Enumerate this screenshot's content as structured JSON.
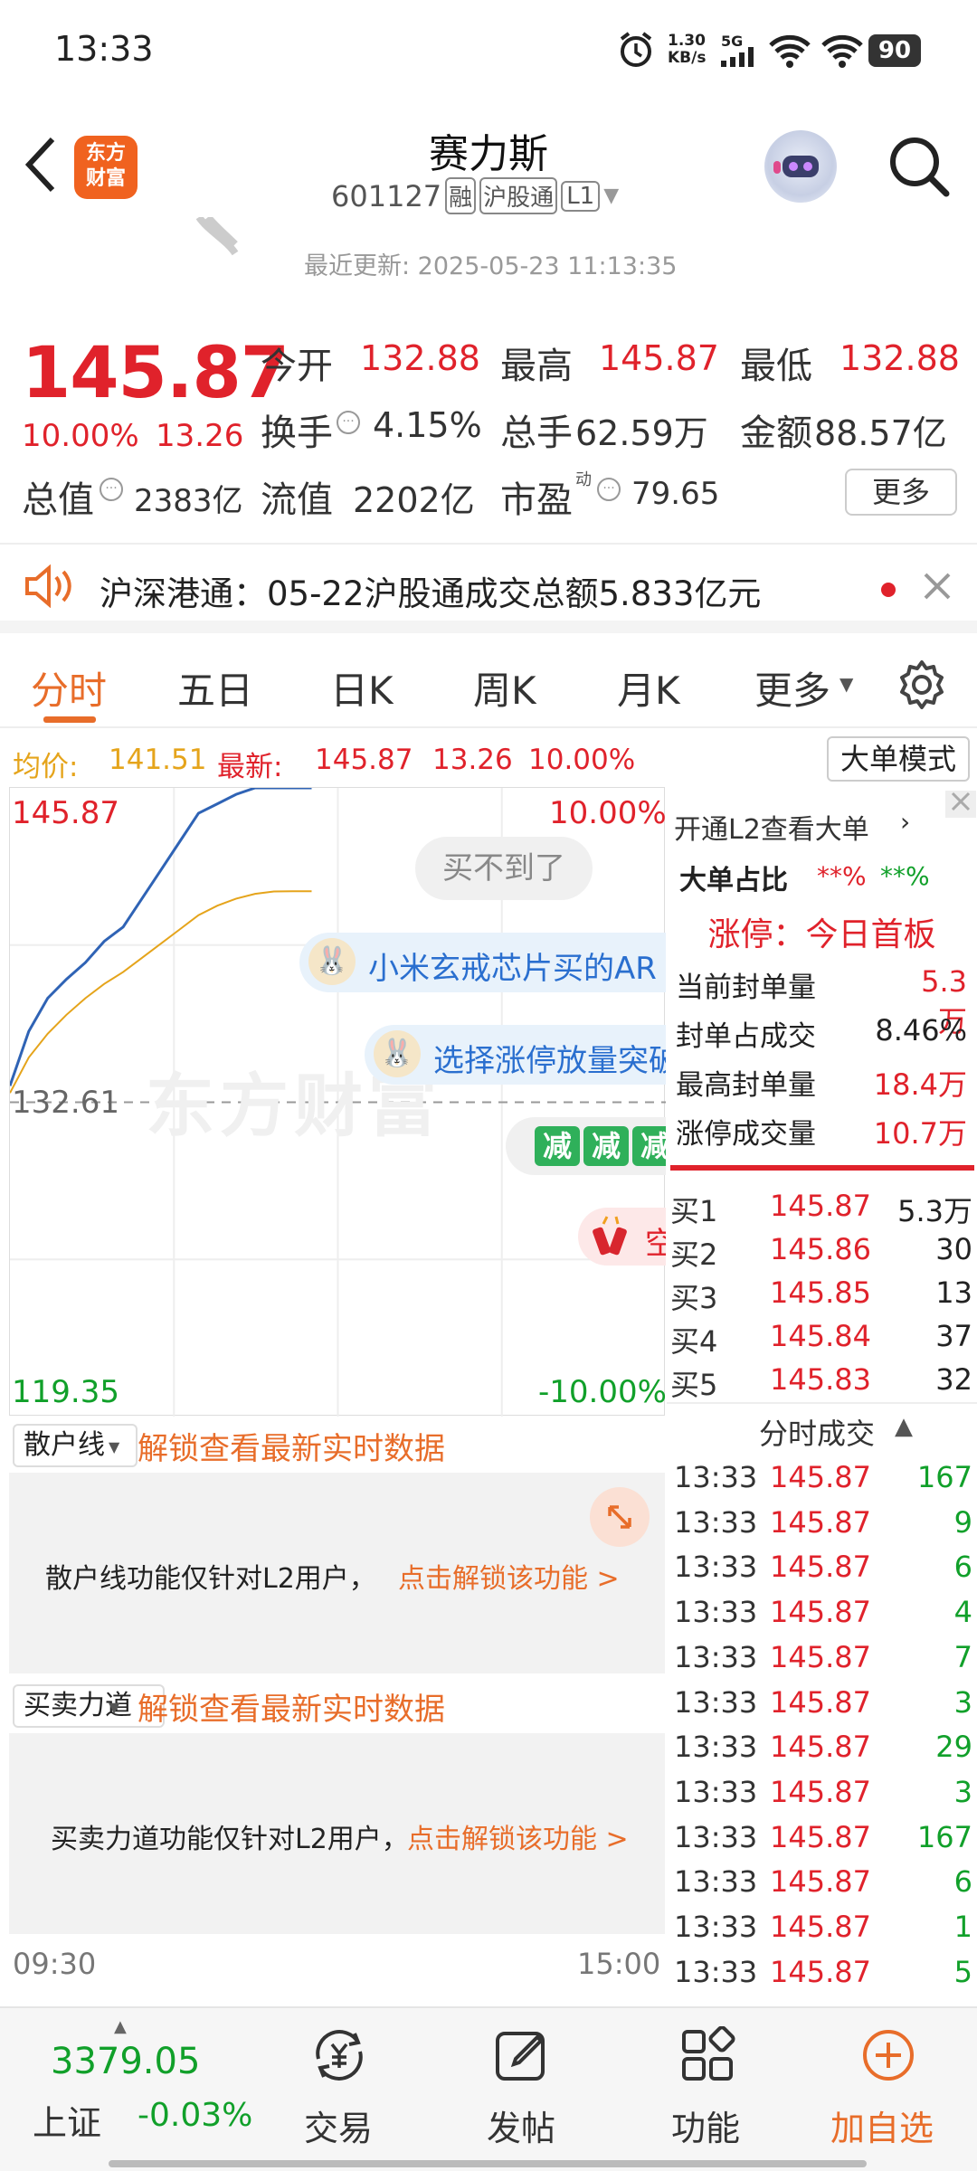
{
  "status": {
    "time": "13:33",
    "net_speed": "1.30\nKB/s",
    "net": "5G",
    "battery": "90"
  },
  "header": {
    "title": "赛力斯",
    "code": "601127",
    "tag_rong": "融",
    "tag_hgt": "沪股通",
    "tag_level": "L1",
    "logo_text": "东方\n财富",
    "update_label": "最近更新: 2025-05-23 11:13:35"
  },
  "quote": {
    "price": "145.87",
    "change_pct": "10.00%",
    "change": "13.26",
    "open_label": "今开",
    "open": "132.88",
    "high_label": "最高",
    "high": "145.87",
    "low_label": "最低",
    "low": "132.88",
    "turnover_label": "换手",
    "turnover": "4.15%",
    "volume_label": "总手",
    "volume": "62.59万",
    "amount_label": "金额",
    "amount": "88.57亿",
    "mcap_label": "总值",
    "mcap": "2383亿",
    "float_label": "流值",
    "float": "2202亿",
    "pe_label": "市盈",
    "pe_sup": "动",
    "pe": "79.65",
    "more": "更多"
  },
  "notice": {
    "text": "沪深港通：05-22沪股通成交总额5.833亿元"
  },
  "tabs": [
    "分时",
    "五日",
    "日K",
    "周K",
    "月K",
    "更多"
  ],
  "chart_header": {
    "avg_label": "均价:",
    "avg": "141.51",
    "latest_label": "最新:",
    "latest": "145.87",
    "chg": "13.26",
    "pct": "10.00%",
    "mode_btn": "大单模式"
  },
  "chart": {
    "y_top": "145.87",
    "y_mid": "132.61",
    "y_bot": "119.35",
    "pct_top": "10.00%",
    "pct_bot": "-10.00%",
    "watermark": "东方财富",
    "bubble1": "买不到了",
    "bubble2": "小米玄戒芯片买的AR",
    "bubble3": "选择涨停放量突破",
    "start": "09:30",
    "end": "15:00"
  },
  "chart_data": {
    "type": "line",
    "x_range": [
      "09:30",
      "15:00"
    ],
    "ylim": [
      119.35,
      145.87
    ],
    "reference": 132.61,
    "series": [
      {
        "name": "",
        "values": [
          133.3,
          135.6,
          137.0,
          137.8,
          138.5,
          139.4,
          140.0,
          141.2,
          142.4,
          143.6,
          144.8,
          145.2,
          145.6,
          145.87,
          145.87,
          145.87,
          145.87
        ]
      },
      {
        "name": "均价",
        "values": [
          133.0,
          134.5,
          135.5,
          136.3,
          137.0,
          137.6,
          138.1,
          138.7,
          139.3,
          139.9,
          140.5,
          140.9,
          141.2,
          141.4,
          141.5,
          141.51,
          141.51
        ]
      }
    ]
  },
  "panel": {
    "l2_link": "开通L2查看大单",
    "big_ratio_label": "大单占比",
    "big_r1": "**%",
    "big_r2": "**%",
    "limit_label": "涨停：今日首板",
    "seal_label": "当前封单量",
    "seal": "5.3万",
    "ratio_label": "封单占成交",
    "ratio": "8.46%",
    "max_label": "最高封单量",
    "max": "18.4万",
    "lvol_label": "涨停成交量",
    "lvol": "10.7万",
    "bids": [
      {
        "l": "买1",
        "p": "145.87",
        "v": "5.3万"
      },
      {
        "l": "买2",
        "p": "145.86",
        "v": "30"
      },
      {
        "l": "买3",
        "p": "145.85",
        "v": "13"
      },
      {
        "l": "买4",
        "p": "145.84",
        "v": "37"
      },
      {
        "l": "买5",
        "p": "145.83",
        "v": "32"
      }
    ],
    "trades_title": "分时成交",
    "trades": [
      {
        "t": "13:33",
        "p": "145.87",
        "v": "167"
      },
      {
        "t": "13:33",
        "p": "145.87",
        "v": "9"
      },
      {
        "t": "13:33",
        "p": "145.87",
        "v": "6"
      },
      {
        "t": "13:33",
        "p": "145.87",
        "v": "4"
      },
      {
        "t": "13:33",
        "p": "145.87",
        "v": "7"
      },
      {
        "t": "13:33",
        "p": "145.87",
        "v": "3"
      },
      {
        "t": "13:33",
        "p": "145.87",
        "v": "29"
      },
      {
        "t": "13:33",
        "p": "145.87",
        "v": "3"
      },
      {
        "t": "13:33",
        "p": "145.87",
        "v": "167"
      },
      {
        "t": "13:33",
        "p": "145.87",
        "v": "6"
      },
      {
        "t": "13:33",
        "p": "145.87",
        "v": "1"
      },
      {
        "t": "13:33",
        "p": "145.87",
        "v": "5"
      }
    ]
  },
  "lower": {
    "retail_sel": "散户线",
    "retail_unlock": "解锁查看最新实时数据",
    "retail_msg": "散户线功能仅针对L2用户，",
    "retail_link": "点击解锁该功能 >",
    "force_sel": "买卖力道",
    "force_unlock": "解锁查看最新实时数据",
    "force_msg": "买卖力道功能仅针对L2用户，",
    "force_link": "点击解锁该功能 >"
  },
  "bottom": {
    "index_val": "3379.05",
    "index_name": "上证",
    "index_chg": "-0.03%",
    "trade": "交易",
    "post": "发帖",
    "func": "功能",
    "watch": "加自选"
  }
}
